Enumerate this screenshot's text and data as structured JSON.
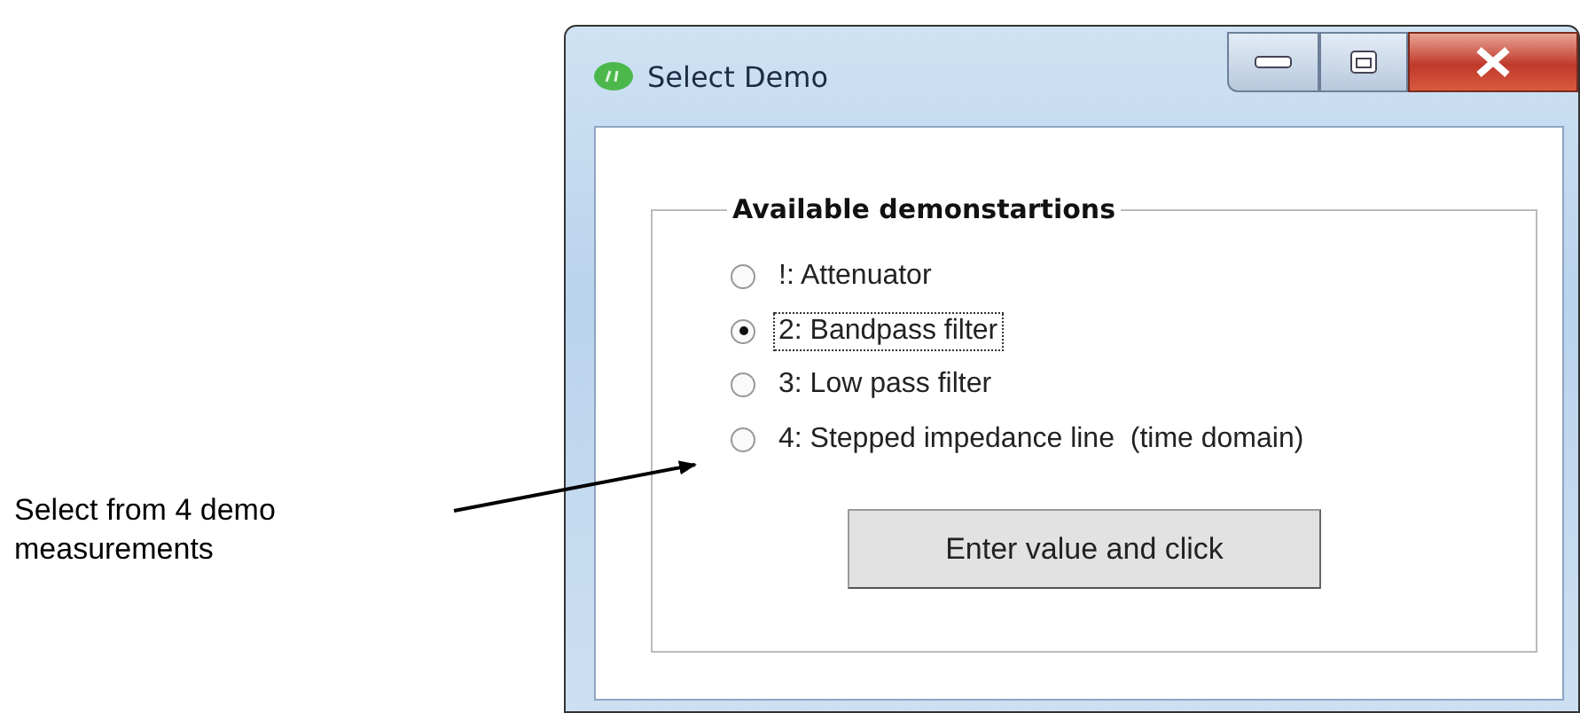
{
  "annotation": {
    "text": "Select from 4 demo measurements"
  },
  "window": {
    "title": "Select Demo",
    "group": {
      "title": "Available demonstartions",
      "options": [
        {
          "label": "!: Attenuator",
          "selected": false,
          "focused": false
        },
        {
          "label": "2: Bandpass filter",
          "selected": true,
          "focused": true
        },
        {
          "label": "3: Low pass filter",
          "selected": false,
          "focused": false
        },
        {
          "label": "4: Stepped impedance line  (time domain)",
          "selected": false,
          "focused": false
        }
      ],
      "button": "Enter value and click"
    }
  }
}
